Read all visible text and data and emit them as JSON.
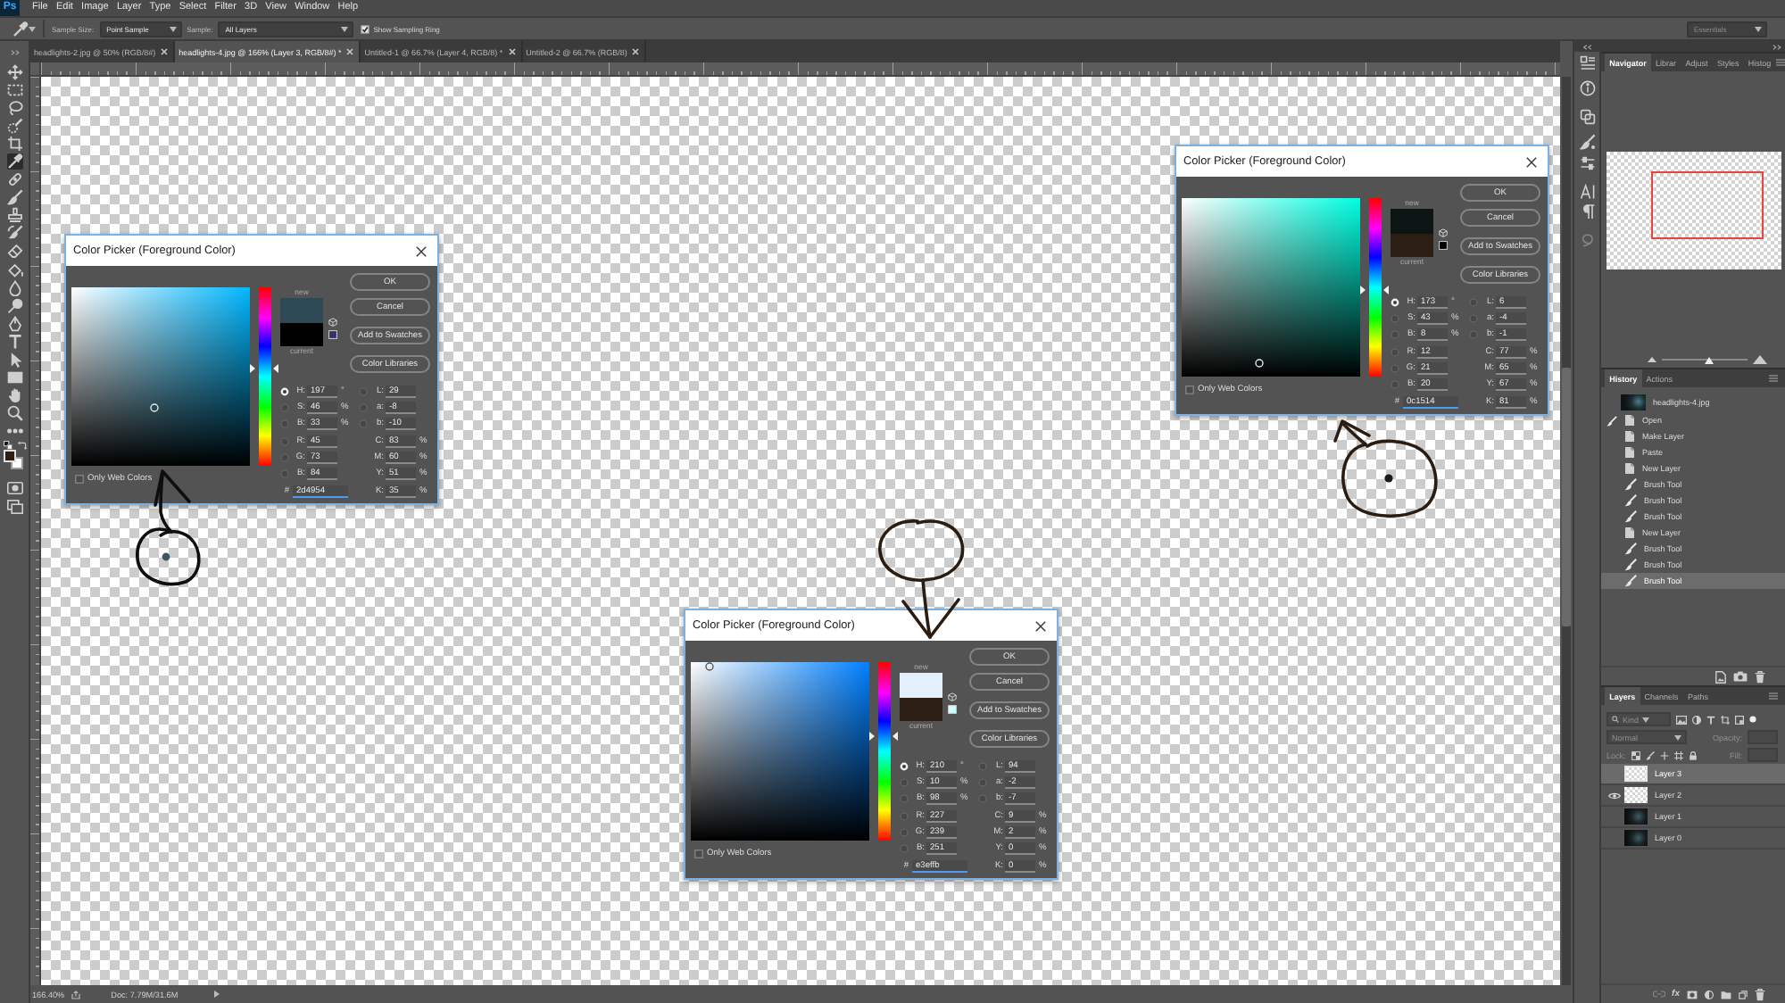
{
  "menu_bar": {
    "logo": "Ps",
    "items": [
      "File",
      "Edit",
      "Image",
      "Layer",
      "Type",
      "Select",
      "Filter",
      "3D",
      "View",
      "Window",
      "Help"
    ]
  },
  "options_bar": {
    "sample_size_label": "Sample Size:",
    "sample_size": "Point Sample",
    "sample_label": "Sample:",
    "sample": "All Layers",
    "sampling_ring": {
      "label": "Show Sampling Ring",
      "checked": true
    },
    "workspace": "Essentials"
  },
  "tools": [
    {
      "selected": false
    },
    {
      "selected": false
    },
    {
      "selected": false
    },
    {
      "selected": false
    },
    {
      "selected": false
    },
    {
      "selected": true
    },
    {
      "selected": false
    },
    {
      "selected": false
    },
    {
      "selected": false
    },
    {
      "selected": false
    },
    {
      "selected": false
    },
    {
      "selected": false
    },
    {
      "selected": false
    },
    {
      "selected": false
    },
    {
      "selected": false
    },
    {
      "selected": false
    },
    {
      "selected": false
    },
    {
      "selected": false
    },
    {
      "selected": false
    },
    {
      "selected": false
    },
    {
      "selected": false
    }
  ],
  "color_swatches": [
    {
      "color": "#2d1e13"
    },
    {
      "color": "#ffffff"
    }
  ],
  "document_tabs": [
    {
      "label": "headlights-2.jpg @ 50% (RGB/8#)",
      "selected": false
    },
    {
      "label": "headlights-4.jpg @ 166% (Layer 3, RGB/8#) *",
      "selected": true
    },
    {
      "label": "Untitled-1 @ 66.7% (Layer 4, RGB/8) *",
      "selected": false
    },
    {
      "label": "Untitled-2 @ 66.7% (RGB/8)",
      "selected": false
    }
  ],
  "dialogs": [
    {
      "title": "Color Picker (Foreground Color)",
      "hue_slider": {
        "level": 0.547
      },
      "swatches": [
        {
          "label": "new",
          "color": "#2d4954"
        },
        {
          "label": "current",
          "color": "#000000"
        }
      ],
      "buttons": [
        "OK",
        "Cancel",
        "Add to Swatches",
        "Color Libraries"
      ],
      "fields": [
        {
          "label": "H:",
          "value": "197",
          "unit": "°",
          "selected": true
        },
        {
          "label": "S:",
          "value": "46",
          "unit": "%",
          "selected": false
        },
        {
          "label": "B:",
          "value": "33",
          "unit": "%",
          "selected": false
        },
        {
          "label": "R:",
          "value": "45",
          "selected": false
        },
        {
          "label": "G:",
          "value": "73",
          "selected": false
        },
        {
          "label": "B:",
          "value": "84",
          "selected": false
        },
        {
          "label": "L:",
          "value": "29",
          "selected": false
        },
        {
          "label": "a:",
          "value": "-8",
          "selected": false
        },
        {
          "label": "b:",
          "value": "-10",
          "selected": false
        }
      ],
      "cmyk": [
        {
          "label": "C:",
          "value": "83",
          "unit": "%"
        },
        {
          "label": "M:",
          "value": "60",
          "unit": "%"
        },
        {
          "label": "Y:",
          "value": "51",
          "unit": "%"
        },
        {
          "label": "K:",
          "value": "35",
          "unit": "%"
        }
      ],
      "hex": {
        "label": "#",
        "value": "2d4954",
        "focused": true
      },
      "only_web_colors": {
        "label": "Only Web Colors",
        "checked": false
      }
    },
    {
      "title": "Color Picker (Foreground Color)",
      "hue_slider": {
        "level": 0.481
      },
      "swatches": [
        {
          "label": "new",
          "color": "#0c1514"
        },
        {
          "label": "current",
          "color": "#2d1e13"
        }
      ],
      "buttons": [
        "OK",
        "Cancel",
        "Add to Swatches",
        "Color Libraries"
      ],
      "fields": [
        {
          "label": "H:",
          "value": "173",
          "unit": "°",
          "selected": true
        },
        {
          "label": "S:",
          "value": "43",
          "unit": "%",
          "selected": false
        },
        {
          "label": "B:",
          "value": "8",
          "unit": "%",
          "selected": false
        },
        {
          "label": "R:",
          "value": "12",
          "selected": false
        },
        {
          "label": "G:",
          "value": "21",
          "selected": false
        },
        {
          "label": "B:",
          "value": "20",
          "selected": false
        },
        {
          "label": "L:",
          "value": "6",
          "selected": false
        },
        {
          "label": "a:",
          "value": "-4",
          "selected": false
        },
        {
          "label": "b:",
          "value": "-1",
          "selected": false
        }
      ],
      "cmyk": [
        {
          "label": "C:",
          "value": "77",
          "unit": "%"
        },
        {
          "label": "M:",
          "value": "65",
          "unit": "%"
        },
        {
          "label": "Y:",
          "value": "67",
          "unit": "%"
        },
        {
          "label": "K:",
          "value": "81",
          "unit": "%"
        }
      ],
      "hex": {
        "label": "#",
        "value": "0c1514",
        "focused": true
      },
      "only_web_colors": {
        "label": "Only Web Colors",
        "checked": false
      }
    },
    {
      "title": "Color Picker (Foreground Color)",
      "hue_slider": {
        "level": 0.583
      },
      "swatches": [
        {
          "label": "new",
          "color": "#e3effb"
        },
        {
          "label": "current",
          "color": "#2d1e13"
        }
      ],
      "buttons": [
        "OK",
        "Cancel",
        "Add to Swatches",
        "Color Libraries"
      ],
      "fields": [
        {
          "label": "H:",
          "value": "210",
          "unit": "°",
          "selected": true
        },
        {
          "label": "S:",
          "value": "10",
          "unit": "%",
          "selected": false
        },
        {
          "label": "B:",
          "value": "98",
          "unit": "%",
          "selected": false
        },
        {
          "label": "R:",
          "value": "227",
          "selected": false
        },
        {
          "label": "G:",
          "value": "239",
          "selected": false
        },
        {
          "label": "B:",
          "value": "251",
          "selected": false
        },
        {
          "label": "L:",
          "value": "94",
          "selected": false
        },
        {
          "label": "a:",
          "value": "-2",
          "selected": false
        },
        {
          "label": "b:",
          "value": "-7",
          "selected": false
        }
      ],
      "cmyk": [
        {
          "label": "C:",
          "value": "9",
          "unit": "%"
        },
        {
          "label": "M:",
          "value": "2",
          "unit": "%"
        },
        {
          "label": "Y:",
          "value": "0",
          "unit": "%"
        },
        {
          "label": "K:",
          "value": "0",
          "unit": "%"
        }
      ],
      "hex": {
        "label": "#",
        "value": "e3effb",
        "focused": true
      },
      "only_web_colors": {
        "label": "Only Web Colors",
        "checked": false
      }
    }
  ],
  "status_bar": {
    "zoom": "166.40%",
    "document_size": "Doc: 7.79M/31.6M"
  },
  "navigator": {
    "tabs": [
      {
        "label": "Navigator",
        "selected": true
      },
      {
        "label": "Librar",
        "selected": false
      },
      {
        "label": "Adjust",
        "selected": false
      },
      {
        "label": "Styles",
        "selected": false
      },
      {
        "label": "Histog",
        "selected": false
      }
    ],
    "zoom_slider": {
      "level": 0.56
    }
  },
  "history": {
    "tabs": [
      {
        "label": "History",
        "selected": true
      },
      {
        "label": "Actions",
        "selected": false
      }
    ],
    "items": [
      {
        "kind": "snapshot",
        "label": "headlights-4.jpg",
        "selected": false,
        "source": false
      },
      {
        "kind": "command",
        "label": "Open",
        "selected": false,
        "source": true
      },
      {
        "kind": "command",
        "label": "Make Layer",
        "selected": false,
        "source": false
      },
      {
        "kind": "command",
        "label": "Paste",
        "selected": false,
        "source": false
      },
      {
        "kind": "command",
        "label": "New Layer",
        "selected": false,
        "source": false
      },
      {
        "kind": "tool",
        "label": "Brush Tool",
        "selected": false,
        "source": false
      },
      {
        "kind": "tool",
        "label": "Brush Tool",
        "selected": false,
        "source": false
      },
      {
        "kind": "tool",
        "label": "Brush Tool",
        "selected": false,
        "source": false
      },
      {
        "kind": "command",
        "label": "New Layer",
        "selected": false,
        "source": false
      },
      {
        "kind": "tool",
        "label": "Brush Tool",
        "selected": false,
        "source": false
      },
      {
        "kind": "tool",
        "label": "Brush Tool",
        "selected": false,
        "source": false
      },
      {
        "kind": "tool",
        "label": "Brush Tool",
        "selected": true,
        "source": false
      }
    ]
  },
  "layers": {
    "tabs": [
      {
        "label": "Layers",
        "selected": true
      },
      {
        "label": "Channels",
        "selected": false
      },
      {
        "label": "Paths",
        "selected": false
      }
    ],
    "filter_kind": "Kind",
    "blend_mode": "Normal",
    "opacity_label": "Opacity:",
    "lock_label": "Lock:",
    "fill_label": "Fill:",
    "effects_button": "fx",
    "items": [
      {
        "name": "Layer 3",
        "kind": "transparent",
        "visible": false,
        "selected": true
      },
      {
        "name": "Layer 2",
        "kind": "transparent",
        "visible": true,
        "selected": false
      },
      {
        "name": "Layer 1",
        "kind": "photo",
        "visible": false,
        "selected": false
      },
      {
        "name": "Layer 0",
        "kind": "photo",
        "visible": false,
        "selected": false
      }
    ]
  }
}
